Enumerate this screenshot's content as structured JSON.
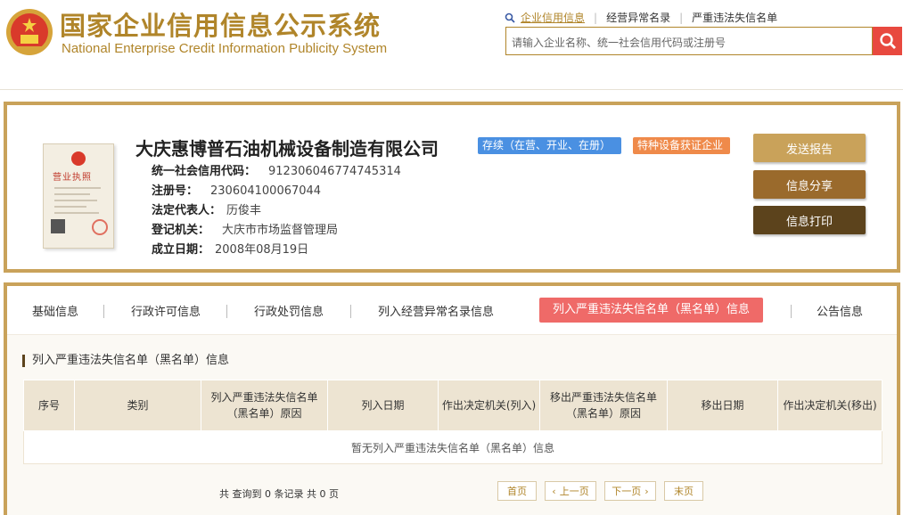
{
  "header": {
    "title_cn": "国家企业信用信息公示系统",
    "title_en": "National Enterprise Credit Information Publicity System",
    "links": [
      "企业信用信息",
      "经营异常名录",
      "严重违法失信名单"
    ],
    "search_placeholder": "请输入企业名称、统一社会信用代码或注册号",
    "accent_color": "#b0852a"
  },
  "company": {
    "name": "大庆惠博普石油机械设备制造有限公司",
    "status_badge": "存续（在营、开业、在册）",
    "tag_badge": "特种设备获证企业",
    "license_title": "营业执照",
    "fields": [
      {
        "label": "统一社会信用代码：",
        "value": "912306046774745314"
      },
      {
        "label": "注册号：",
        "value": "230604100067044"
      },
      {
        "label": "法定代表人：",
        "value": "历俊丰"
      },
      {
        "label": "登记机关：",
        "value": "大庆市市场监督管理局"
      },
      {
        "label": "成立日期：",
        "value": "2008年08月19日"
      }
    ],
    "actions": [
      "发送报告",
      "信息分享",
      "信息打印"
    ]
  },
  "tabs": [
    "基础信息",
    "行政许可信息",
    "行政处罚信息",
    "列入经营异常名录信息",
    "列入严重违法失信名单（黑名单）信息",
    "公告信息"
  ],
  "section": {
    "title": "列入严重违法失信名单（黑名单）信息",
    "columns": [
      "序号",
      "类别",
      "列入严重违法失信名单（黑名单）原因",
      "列入日期",
      "作出决定机关(列入)",
      "移出严重违法失信名单（黑名单）原因",
      "移出日期",
      "作出决定机关(移出)"
    ],
    "empty_text": "暂无列入严重违法失信名单（黑名单）信息",
    "pager_info": "共 查询到 0 条记录 共 0 页",
    "pager": {
      "first": "首页",
      "prev": "上一页",
      "next": "下一页",
      "last": "末页"
    }
  }
}
